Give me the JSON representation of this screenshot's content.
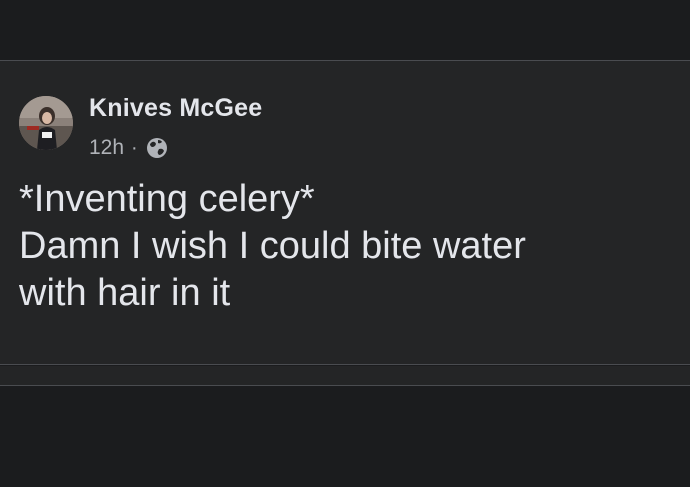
{
  "post": {
    "author": "Knives McGee",
    "timestamp": "12h",
    "separator": "·",
    "privacy_icon": "globe-icon",
    "avatar_icon": "profile-photo",
    "text_lines": [
      "*Inventing celery*",
      "Damn I wish I could bite water",
      "with hair in it"
    ]
  },
  "colors": {
    "background": "#1b1c1e",
    "card": "#242526",
    "divider": "#4a4c50",
    "primary_text": "#e4e6eb",
    "secondary_text": "#b0b3b8"
  }
}
